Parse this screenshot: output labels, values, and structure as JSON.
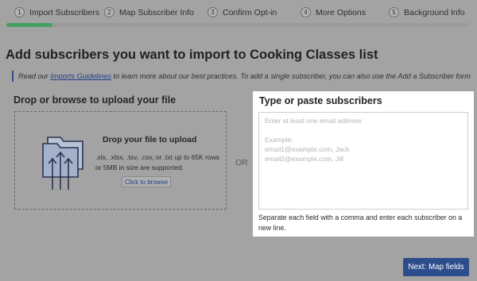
{
  "stepper": {
    "steps": [
      {
        "num": "1",
        "label": "Import Subscribers"
      },
      {
        "num": "2",
        "label": "Map Subscriber Info"
      },
      {
        "num": "3",
        "label": "Confirm Opt-in"
      },
      {
        "num": "4",
        "label": "More Options"
      },
      {
        "num": "5",
        "label": "Background Info"
      }
    ],
    "active_step": 1,
    "progress_fraction": 0.1,
    "progress_color": "#45a160"
  },
  "main": {
    "heading": "Add subscribers you want to import to Cooking Classes list",
    "note": {
      "prefix": "Read our ",
      "link_text": "Imports Guidelines",
      "suffix": " to learn more about our best practices. To add a single subscriber, you can also use the Add a Subscriber form"
    }
  },
  "upload": {
    "title": "Drop or browse to upload your file",
    "drop_heading": "Drop your file to upload",
    "info": ".xls, .xlsx, .tsv, .csv, or .txt up to 65K rows or 5MB in size are supported.",
    "browse_label": "Click to browse",
    "icon": "folder-upload-icon"
  },
  "divider": {
    "or": "OR"
  },
  "paste": {
    "title": "Type or paste subscribers",
    "placeholder_lines": [
      "Enter at least one email address",
      "",
      "Example:",
      "email1@example.com, Jack",
      "email2@example.com, Jill"
    ],
    "helper": "Separate each field with a comma and enter each subscriber on a new line."
  },
  "footer": {
    "next_label": "Next: Map fields"
  },
  "colors": {
    "accent": "#2b4d8c",
    "overlay": "#a3a3a3",
    "link": "#1f3f87"
  }
}
